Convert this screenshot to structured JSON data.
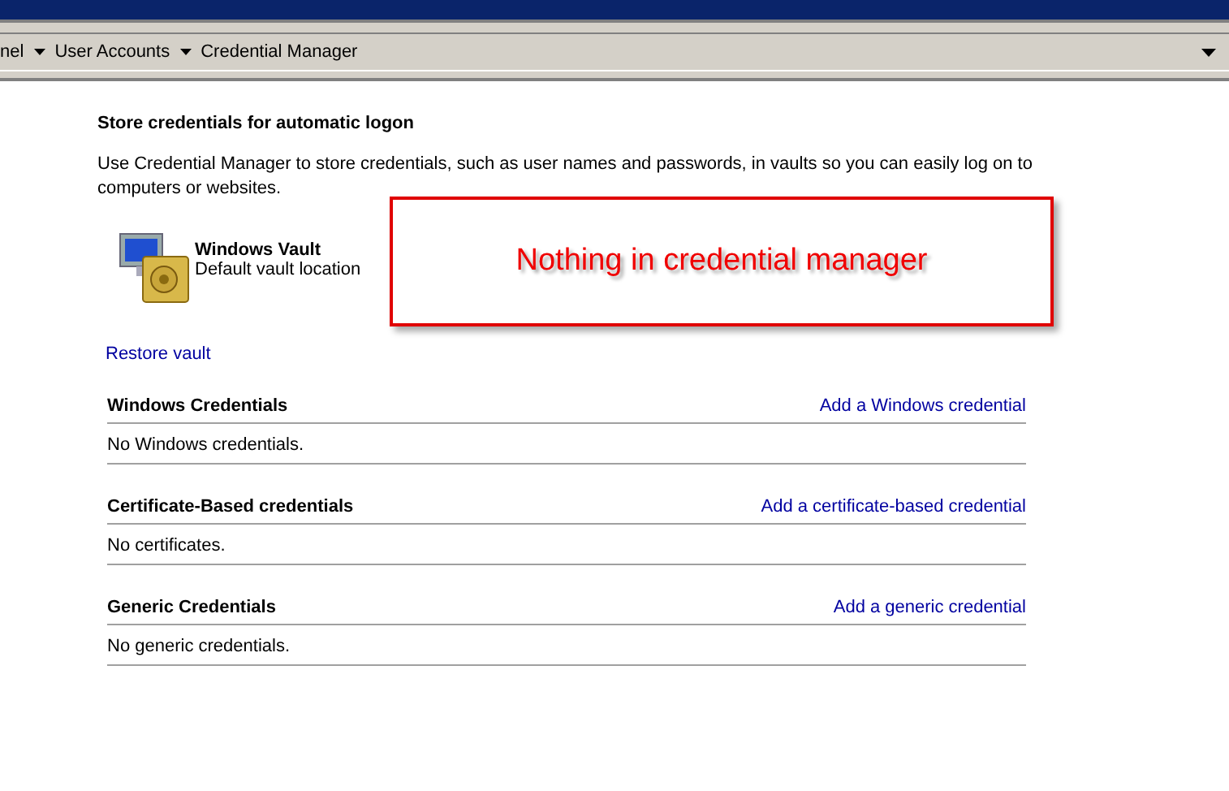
{
  "breadcrumb": [
    "nel",
    "User Accounts",
    "Credential Manager"
  ],
  "heading": "Store credentials for automatic logon",
  "description": "Use Credential Manager to store credentials, such as user names and passwords, in vaults so you can easily log on to computers or websites.",
  "vault": {
    "name": "Windows Vault",
    "location": "Default vault location"
  },
  "restore_link": "Restore vault",
  "sections": [
    {
      "title": "Windows Credentials",
      "action": "Add a Windows credential",
      "empty": "No Windows credentials."
    },
    {
      "title": "Certificate-Based credentials",
      "action": "Add a certificate-based credential",
      "empty": "No certificates."
    },
    {
      "title": "Generic Credentials",
      "action": "Add a generic credential",
      "empty": "No generic credentials."
    }
  ],
  "annotation": "Nothing in credential manager"
}
